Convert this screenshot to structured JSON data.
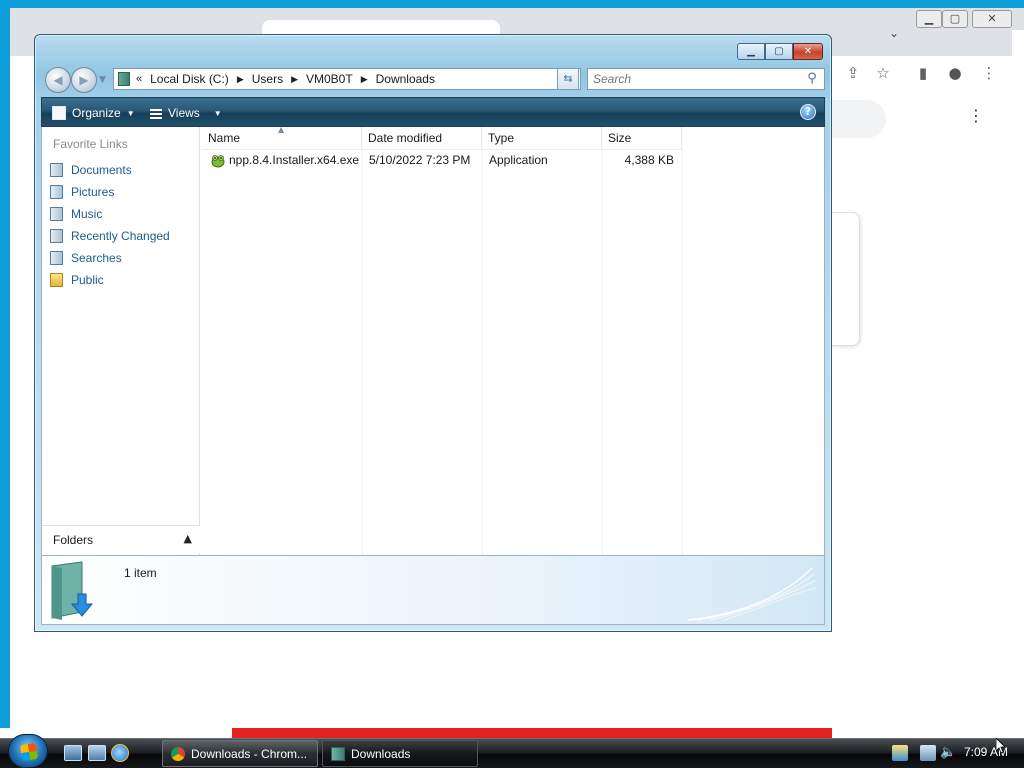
{
  "explorer": {
    "window_title_buttons": {
      "minimize": "▁",
      "maximize": "▢",
      "close": "✕"
    },
    "breadcrumb": {
      "lead": "«",
      "items": [
        "Local Disk (C:)",
        "Users",
        "VM0B0T",
        "Downloads"
      ],
      "separator": "▶"
    },
    "search": {
      "placeholder": "Search"
    },
    "toolbar": {
      "organize_label": "Organize",
      "views_label": "Views",
      "help_label": "?"
    },
    "favorites": {
      "heading": "Favorite Links",
      "items": [
        "Documents",
        "Pictures",
        "Music",
        "Recently Changed",
        "Searches",
        "Public"
      ]
    },
    "folders_label": "Folders",
    "columns": {
      "name": "Name",
      "date": "Date modified",
      "type": "Type",
      "size": "Size"
    },
    "files": [
      {
        "name": "npp.8.4.Installer.x64.exe",
        "date": "5/10/2022 7:23 PM",
        "type": "Application",
        "size": "4,388 KB",
        "icon": "notepad-plus-plus-icon"
      }
    ],
    "details": {
      "count_text": "1 item"
    }
  },
  "taskbar": {
    "buttons": [
      {
        "label": "Downloads - Chrom...",
        "icon": "chrome-icon"
      },
      {
        "label": "Downloads",
        "icon": "folder-icon"
      }
    ],
    "clock": "7:09 AM"
  },
  "background": {
    "chrome_buttons": {
      "minimize": "▁",
      "restore": "▢",
      "close": "✕"
    },
    "chrome_menu": "⋮"
  },
  "colors": {
    "accent": "#0b9ed8",
    "link": "#1d5b8e",
    "command_bar": "#2a5876"
  }
}
